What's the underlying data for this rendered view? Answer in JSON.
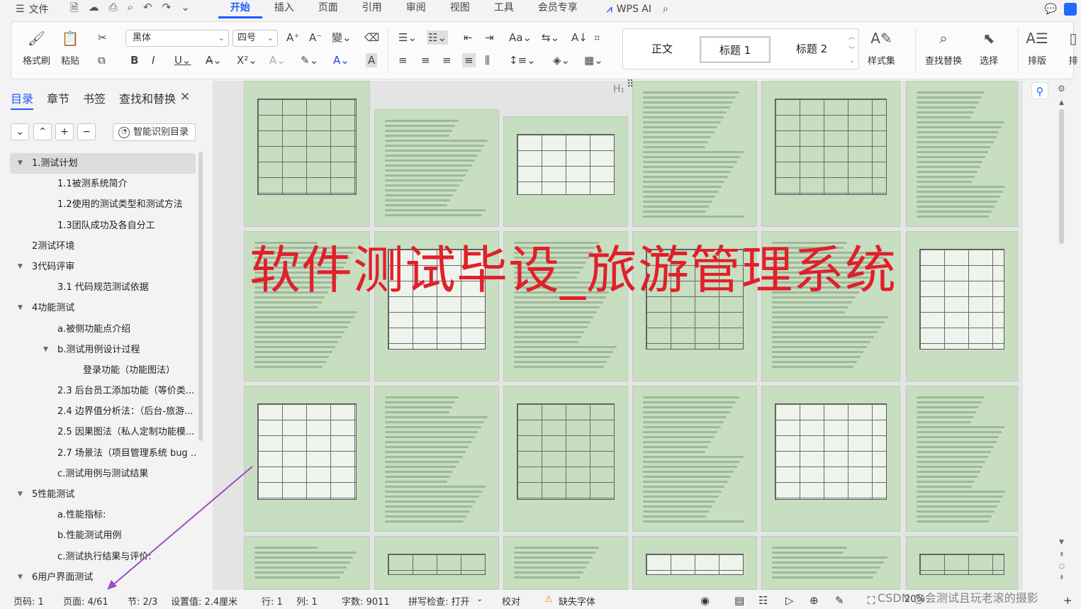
{
  "menubar": {
    "file_label": "文件",
    "tabs": [
      "开始",
      "插入",
      "页面",
      "引用",
      "审阅",
      "视图",
      "工具",
      "会员专享"
    ],
    "active_tab": "开始",
    "wps_ai": "WPS AI"
  },
  "ribbon": {
    "format_painter": "格式刷",
    "paste": "粘贴",
    "font_name": "黑体",
    "font_size": "四号",
    "styles": [
      "正文",
      "标题 1",
      "标题 2"
    ],
    "styles_gallery": "样式集",
    "find_replace": "查找替换",
    "select": "选择",
    "layout": "排版",
    "layout_more": "排"
  },
  "sidebar": {
    "tabs": [
      "目录",
      "章节",
      "书签",
      "查找和替换"
    ],
    "smart_toc": "智能识别目录",
    "toc": [
      {
        "label": "1.测试计划",
        "level": 0,
        "expanded": true,
        "active": true
      },
      {
        "label": "1.1被测系统简介",
        "level": 1
      },
      {
        "label": "1.2使用的测试类型和测试方法",
        "level": 1
      },
      {
        "label": "1.3团队成功及各自分工",
        "level": 1
      },
      {
        "label": "2测试环境",
        "level": 0
      },
      {
        "label": "3代码评审",
        "level": 0,
        "expanded": true
      },
      {
        "label": "3.1 代码规范测试依据",
        "level": 1
      },
      {
        "label": "4功能测试",
        "level": 0,
        "expanded": true
      },
      {
        "label": "a.被侧功能点介绍",
        "level": 1
      },
      {
        "label": "b.测试用例设计过程",
        "level": 1,
        "expanded": true
      },
      {
        "label": "登录功能（功能图法）",
        "level": 2
      },
      {
        "label": "2.3 后台员工添加功能（等价类...",
        "level": 1
      },
      {
        "label": "2.4 边界值分析法：（后台-旅游...",
        "level": 1
      },
      {
        "label": "2.5 因果图法（私人定制功能模...",
        "level": 1
      },
      {
        "label": "2.7 场景法（项目管理系统 bug ...",
        "level": 1
      },
      {
        "label": "c.测试用例与测试结果",
        "level": 1
      },
      {
        "label": "5性能测试",
        "level": 0,
        "expanded": true
      },
      {
        "label": "a.性能指标:",
        "level": 1
      },
      {
        "label": "b.性能测试用例",
        "level": 1
      },
      {
        "label": "c.测试执行结果与评价:",
        "level": 1
      },
      {
        "label": "6用户界面测试",
        "level": 0,
        "expanded": true
      }
    ]
  },
  "document": {
    "overlay_title": "软件测试毕设_旅游管理系统",
    "title_color": "#e0202a",
    "page_bg_color": "#c7dec1"
  },
  "statusbar": {
    "page_code": "页码: 1",
    "page": "页面: 4/61",
    "section": "节: 2/3",
    "setting": "设置值: 2.4厘米",
    "row": "行: 1",
    "col": "列: 1",
    "word_count": "字数: 9011",
    "spell_check": "拼写检查: 打开",
    "proof": "校对",
    "missing_font": "缺失字体",
    "zoom": "20%"
  },
  "watermark": "CSDN @会测试且玩老滚的摄影"
}
